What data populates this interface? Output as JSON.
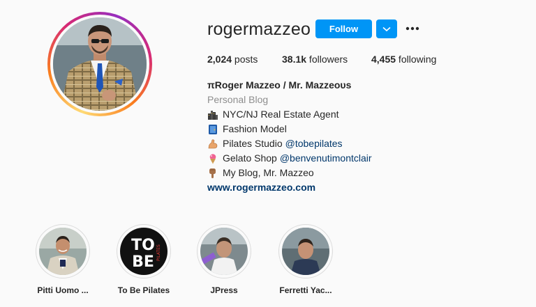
{
  "profile": {
    "username": "rogermazzeo",
    "follow_label": "Follow",
    "stats": {
      "posts_count": "2,024",
      "posts_label": " posts",
      "followers_count": "38.1k",
      "followers_label": " followers",
      "following_count": "4,455",
      "following_label": " following"
    },
    "bio": {
      "name": "πRoger Mazzeo / Mr. Mazzeoυs",
      "category": "Personal Blog",
      "lines": [
        {
          "icon": "cityscape-icon",
          "text": "NYC/NJ Real Estate Agent",
          "mention": ""
        },
        {
          "icon": "door-icon",
          "text": "Fashion Model",
          "mention": ""
        },
        {
          "icon": "flexed-biceps-icon",
          "text": "Pilates Studio",
          "mention": "@tobepilates"
        },
        {
          "icon": "ice-cream-icon",
          "text": "Gelato Shop",
          "mention": "@benvenutimontclair"
        },
        {
          "icon": "pointing-down-icon",
          "text": "My Blog, Mr. Mazzeo",
          "mention": ""
        }
      ],
      "website": "www.rogermazzeo.com"
    },
    "highlights": [
      {
        "label": "Pitti Uomo ..."
      },
      {
        "label": "To Be Pilates"
      },
      {
        "label": "JPress"
      },
      {
        "label": "Ferretti Yac..."
      }
    ],
    "colors": {
      "accent": "#0095f6",
      "link": "#00376b",
      "muted": "#8e8e8e",
      "text": "#262626",
      "background": "#fafafa"
    }
  }
}
